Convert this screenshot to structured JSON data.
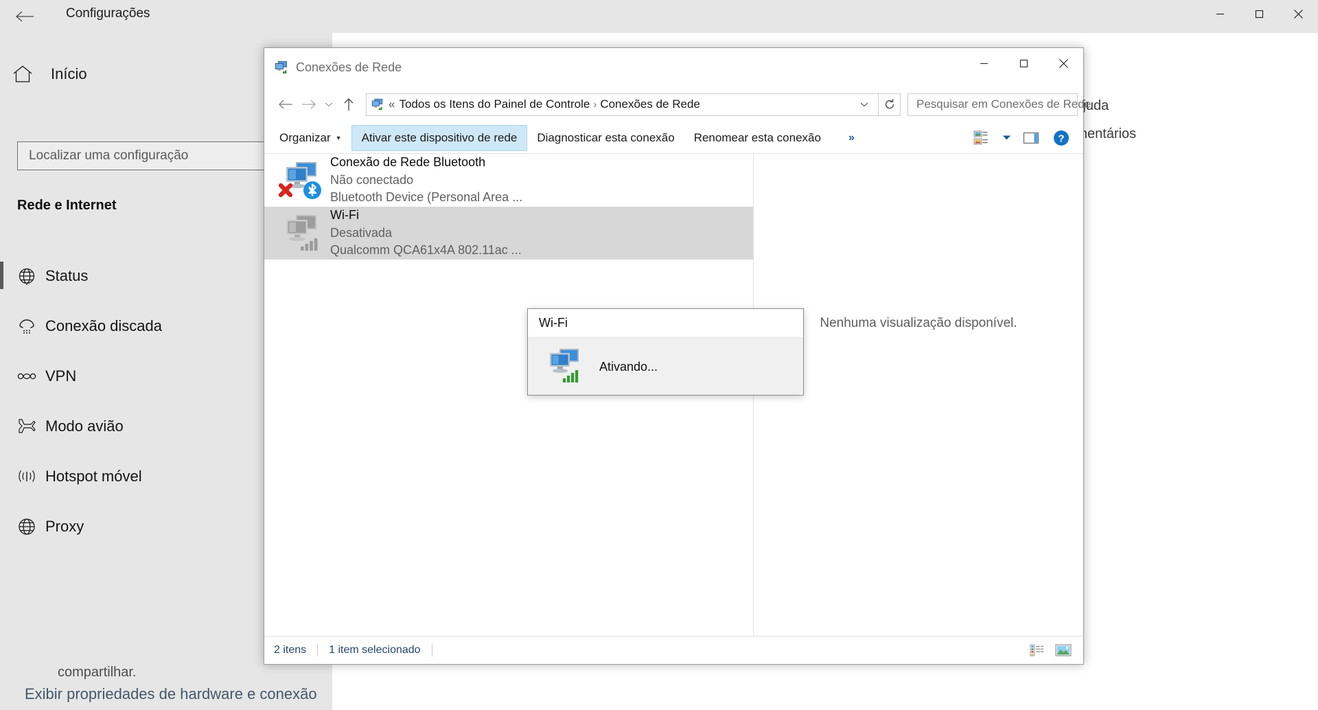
{
  "settings": {
    "titlebar": {
      "back_icon": "back-arrow-icon",
      "title": "Configurações",
      "minimize_label": "─",
      "maximize_label": "☐",
      "close_label": "✕"
    },
    "home": {
      "icon": "home-icon",
      "label": "Início"
    },
    "search": {
      "placeholder": "Localizar uma configuração",
      "icon": "search-icon"
    },
    "heading": "Rede e Internet",
    "nav_items": [
      {
        "label": "Status",
        "icon": "globe-icon",
        "selected": true
      },
      {
        "label": "Conexão discada",
        "icon": "dialup-icon",
        "selected": false
      },
      {
        "label": "VPN",
        "icon": "vpn-icon",
        "selected": false
      },
      {
        "label": "Modo avião",
        "icon": "airplane-icon",
        "selected": false
      },
      {
        "label": "Hotspot móvel",
        "icon": "hotspot-icon",
        "selected": false
      },
      {
        "label": "Proxy",
        "icon": "globe-icon",
        "selected": false
      }
    ],
    "help_links": [
      {
        "label": "Obtenha ajuda"
      },
      {
        "label": "Enviar comentários"
      }
    ],
    "content": {
      "share_text": "compartilhar.",
      "hardware_link": "Exibir propriedades de hardware e conexão"
    }
  },
  "explorer": {
    "titlebar": {
      "icon": "network-connections-icon",
      "title": "Conexões de Rede",
      "minimize_label": "─",
      "maximize_label": "☐",
      "close_label": "✕"
    },
    "addressbar": {
      "back_icon": "back-arrow-icon",
      "forward_icon": "forward-arrow-icon",
      "recent_icon": "chevron-down-icon",
      "up_icon": "up-arrow-icon",
      "breadcrumb_icon": "network-connections-icon",
      "breadcrumb_prefix": "«",
      "breadcrumb": [
        "Todos os Itens do Painel de Controle",
        "Conexões de Rede"
      ],
      "breadcrumb_separator": "›",
      "dropdown_icon": "chevron-down-icon",
      "refresh_icon": "refresh-icon",
      "search_placeholder": "Pesquisar em Conexões de Rede",
      "search_icon": "search-icon"
    },
    "commandbar": {
      "organize_label": "Organizar",
      "organize_caret": "▼",
      "buttons": [
        {
          "label": "Ativar este dispositivo de rede",
          "active": true
        },
        {
          "label": "Diagnosticar esta conexão",
          "active": false
        },
        {
          "label": "Renomear esta conexão",
          "active": false
        }
      ],
      "overflow_label": "»",
      "view_icon": "view-options-icon",
      "view_caret": "▼",
      "pane_icon": "preview-pane-icon",
      "help_icon": "help-icon"
    },
    "connections": [
      {
        "name": "Conexão de Rede Bluetooth",
        "status": "Não conectado",
        "device": "Bluetooth Device (Personal Area ...",
        "icon": "network-adapter-disabled-icon",
        "badge": "bluetooth-icon",
        "error_badge": "red-x-icon",
        "selected": false
      },
      {
        "name": "Wi-Fi",
        "status": "Desativada",
        "device": "Qualcomm QCA61x4A 802.11ac ...",
        "icon": "network-adapter-greyed-icon",
        "badge": "signal-bars-grey-icon",
        "selected": true
      }
    ],
    "preview": {
      "empty_text": "Nenhuma visualização disponível."
    },
    "statusbar": {
      "item_count": "2 itens",
      "selection": "1 item selecionado",
      "details_view_icon": "details-view-icon",
      "large_icons_view_icon": "large-icons-view-icon"
    }
  },
  "progress_dialog": {
    "title": "Wi-Fi",
    "message": "Ativando...",
    "icon": "network-adapter-active-icon"
  },
  "colors": {
    "settings_chrome": "#e6e6e6",
    "accent_selected_row": "#d7d7d7",
    "command_active_bg": "#cfe8f7",
    "command_active_border": "#a8d8f0",
    "status_text": "#26476b",
    "bluetooth_blue": "#1f8fe0",
    "error_red": "#d8251d",
    "signal_green": "#3da33d"
  }
}
